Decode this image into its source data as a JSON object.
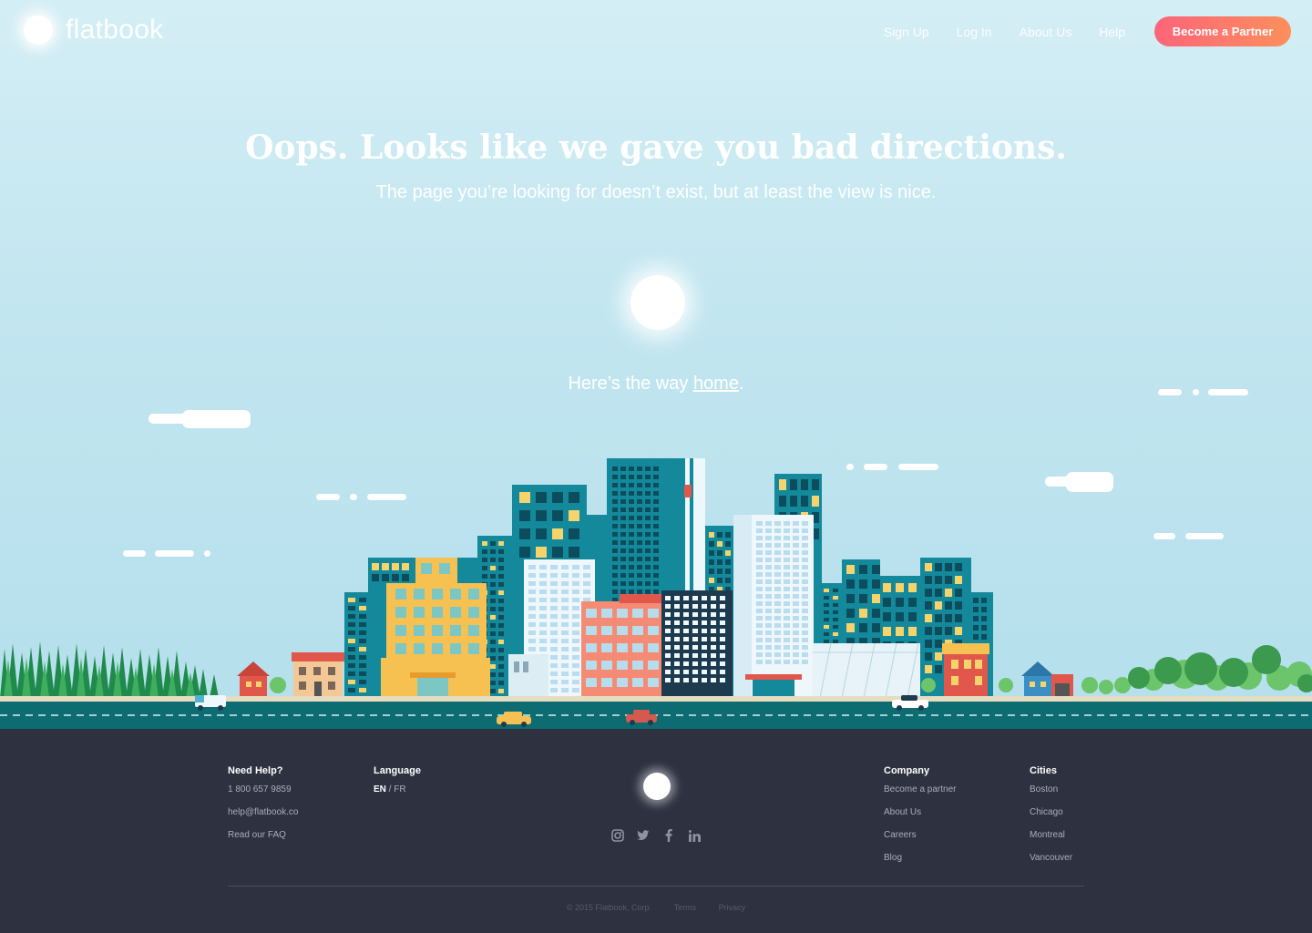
{
  "brand": {
    "name": "flatbook"
  },
  "nav": {
    "items": [
      "Sign Up",
      "Log In",
      "About Us",
      "Help"
    ],
    "cta": "Become a Partner"
  },
  "hero": {
    "title": "Oops. Looks like we gave you bad directions.",
    "subtitle": "The page you’re looking for doesn’t exist, but at least the view is nice.",
    "home_prefix": "Here’s the way ",
    "home_link": "home",
    "home_suffix": "."
  },
  "footer": {
    "help": {
      "title": "Need Help?",
      "phone": "1 800 657 9859",
      "email": "help@flatbook.co",
      "faq": "Read our FAQ"
    },
    "language": {
      "title": "Language",
      "current": "EN",
      "separator": " / ",
      "other": "FR"
    },
    "social": [
      "instagram-icon",
      "twitter-icon",
      "facebook-icon",
      "linkedin-icon"
    ],
    "company": {
      "title": "Company",
      "links": [
        "Become a partner",
        "About Us",
        "Careers",
        "Blog"
      ]
    },
    "cities": {
      "title": "Cities",
      "links": [
        "Boston",
        "Chicago",
        "Montreal",
        "Vancouver"
      ]
    },
    "legal": {
      "copyright": "© 2015 Flatbook, Corp.",
      "terms": "Terms",
      "privacy": "Privacy"
    }
  },
  "colors": {
    "sky": "#c3e6f0",
    "cta_start": "#ff5e73",
    "cta_end": "#ff8a55",
    "footer_bg": "#2d3140",
    "road": "#0d6b72"
  }
}
